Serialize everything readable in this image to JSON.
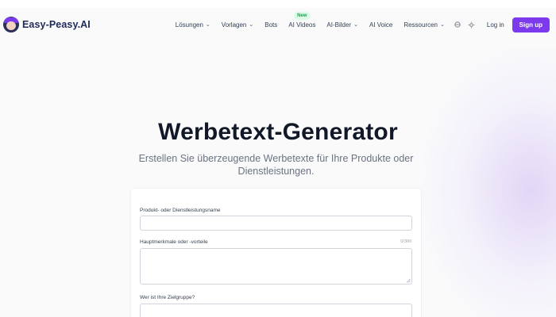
{
  "brand": {
    "name": "Easy-Peasy.AI",
    "accent": "#7c3aed"
  },
  "nav": {
    "items": [
      {
        "label": "Lösungen",
        "dropdown": true
      },
      {
        "label": "Vorlagen",
        "dropdown": true
      },
      {
        "label": "Bots",
        "dropdown": false
      },
      {
        "label": "AI Videos",
        "dropdown": false,
        "badge": "New"
      },
      {
        "label": "AI-Bilder",
        "dropdown": true
      },
      {
        "label": "AI Voice",
        "dropdown": false
      },
      {
        "label": "Ressourcen",
        "dropdown": true
      }
    ],
    "login_label": "Log in",
    "signup_label": "Sign up",
    "icons": [
      "globe-icon",
      "theme-toggle-icon"
    ]
  },
  "hero": {
    "title": "Werbetext-Generator",
    "subtitle": "Erstellen Sie überzeugende Werbetexte für Ihre Produkte oder Dienstleistungen."
  },
  "form": {
    "product_label": "Produkt- oder Dienstleistungsname",
    "product_value": "",
    "features_label": "Hauptmerkmale oder -vorteile",
    "features_counter": "0/300",
    "features_value": "",
    "audience_label": "Wer ist Ihre Zielgruppe?",
    "audience_value": ""
  }
}
